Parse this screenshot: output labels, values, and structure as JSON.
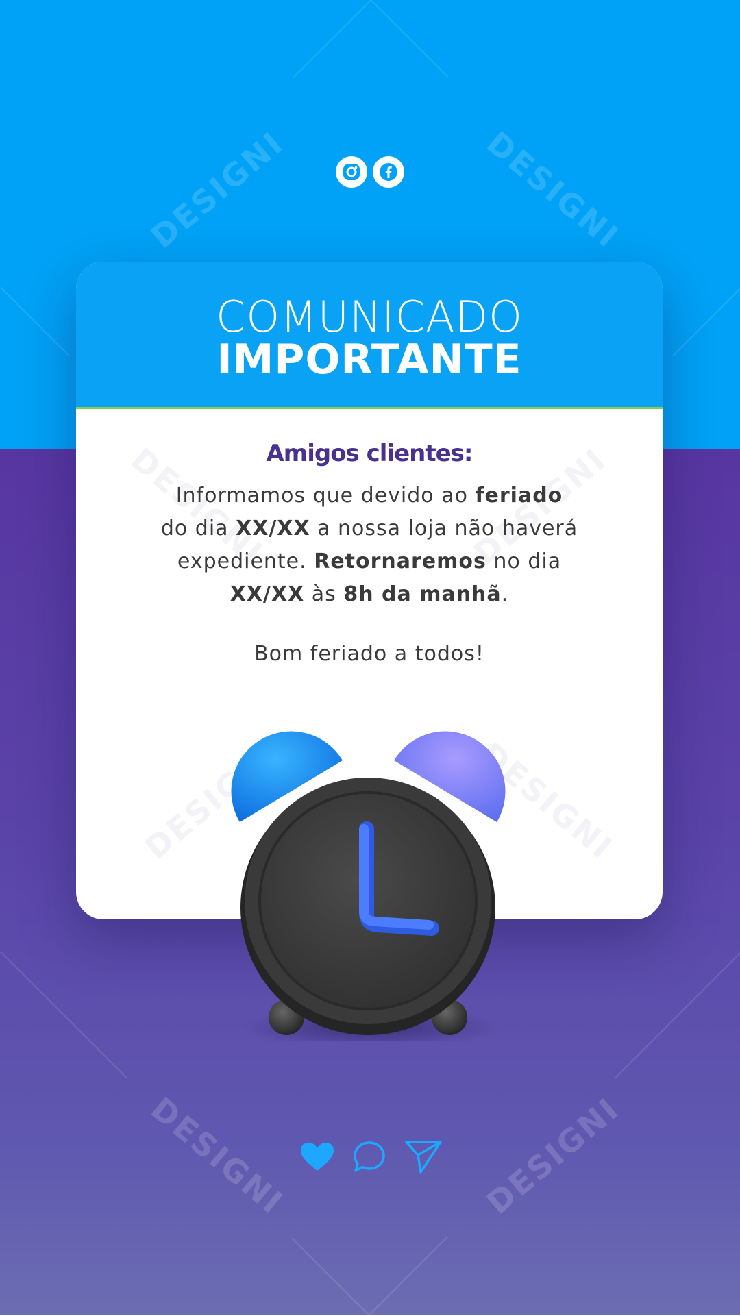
{
  "social": {
    "instagram_icon": "instagram-icon",
    "facebook_icon": "facebook-icon"
  },
  "watermark": "DESIGNI",
  "card": {
    "title_line1": "COMUNICADO",
    "title_line2": "IMPORTANTE",
    "greeting": "Amigos clientes:",
    "message": {
      "p1": "Informamos que devido ao ",
      "b1": "feriado",
      "p2": "do dia ",
      "b2": "XX/XX",
      "p3": " a nossa loja não haverá",
      "p4": "expediente. ",
      "b3": "Retornaremos",
      "p5": " no dia",
      "b4": "XX/XX",
      "p6": " às ",
      "b5": "8h da manhã",
      "p7": "."
    },
    "closing": "Bom feriado a todos!"
  },
  "colors": {
    "sky": "#00a2f7",
    "purple": "#5836a2",
    "accent_green": "#7fd34a",
    "heading": "#48318f"
  },
  "actions": {
    "like_icon": "heart-icon",
    "comment_icon": "comment-icon",
    "share_icon": "send-icon"
  }
}
